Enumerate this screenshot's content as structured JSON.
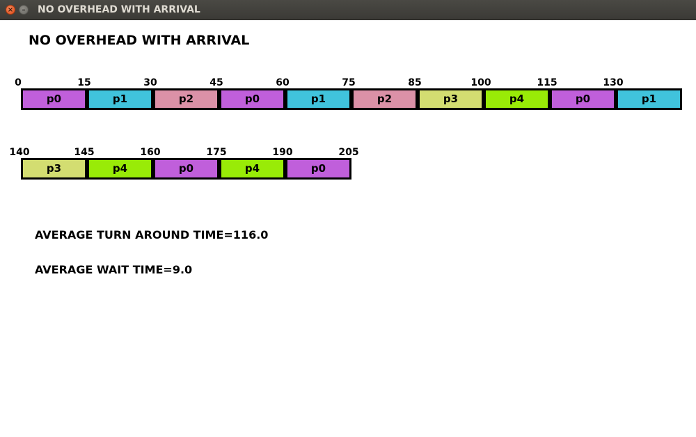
{
  "window": {
    "title": "NO OVERHEAD WITH ARRIVAL",
    "close_icon": "close-icon",
    "minimize_icon": "minimize-icon"
  },
  "heading": "NO OVERHEAD WITH ARRIVAL",
  "colors": {
    "p0": "#c05fdb",
    "p1": "#40c3dc",
    "p2": "#db91a7",
    "p3": "#d3dd71",
    "p4": "#99eb07"
  },
  "gantt": {
    "rows": [
      {
        "ticks": [
          "0",
          "15",
          "30",
          "45",
          "60",
          "75",
          "85",
          "100",
          "115",
          "130"
        ],
        "blocks": [
          "p0",
          "p1",
          "p2",
          "p0",
          "p1",
          "p2",
          "p3",
          "p4",
          "p0",
          "p1"
        ]
      },
      {
        "ticks": [
          "140",
          "145",
          "160",
          "175",
          "190",
          "205"
        ],
        "blocks": [
          "p3",
          "p4",
          "p0",
          "p4",
          "p0"
        ]
      }
    ]
  },
  "stats": {
    "avg_turnaround": "AVERAGE TURN AROUND TIME=116.0",
    "avg_wait": "AVERAGE WAIT TIME=9.0"
  }
}
